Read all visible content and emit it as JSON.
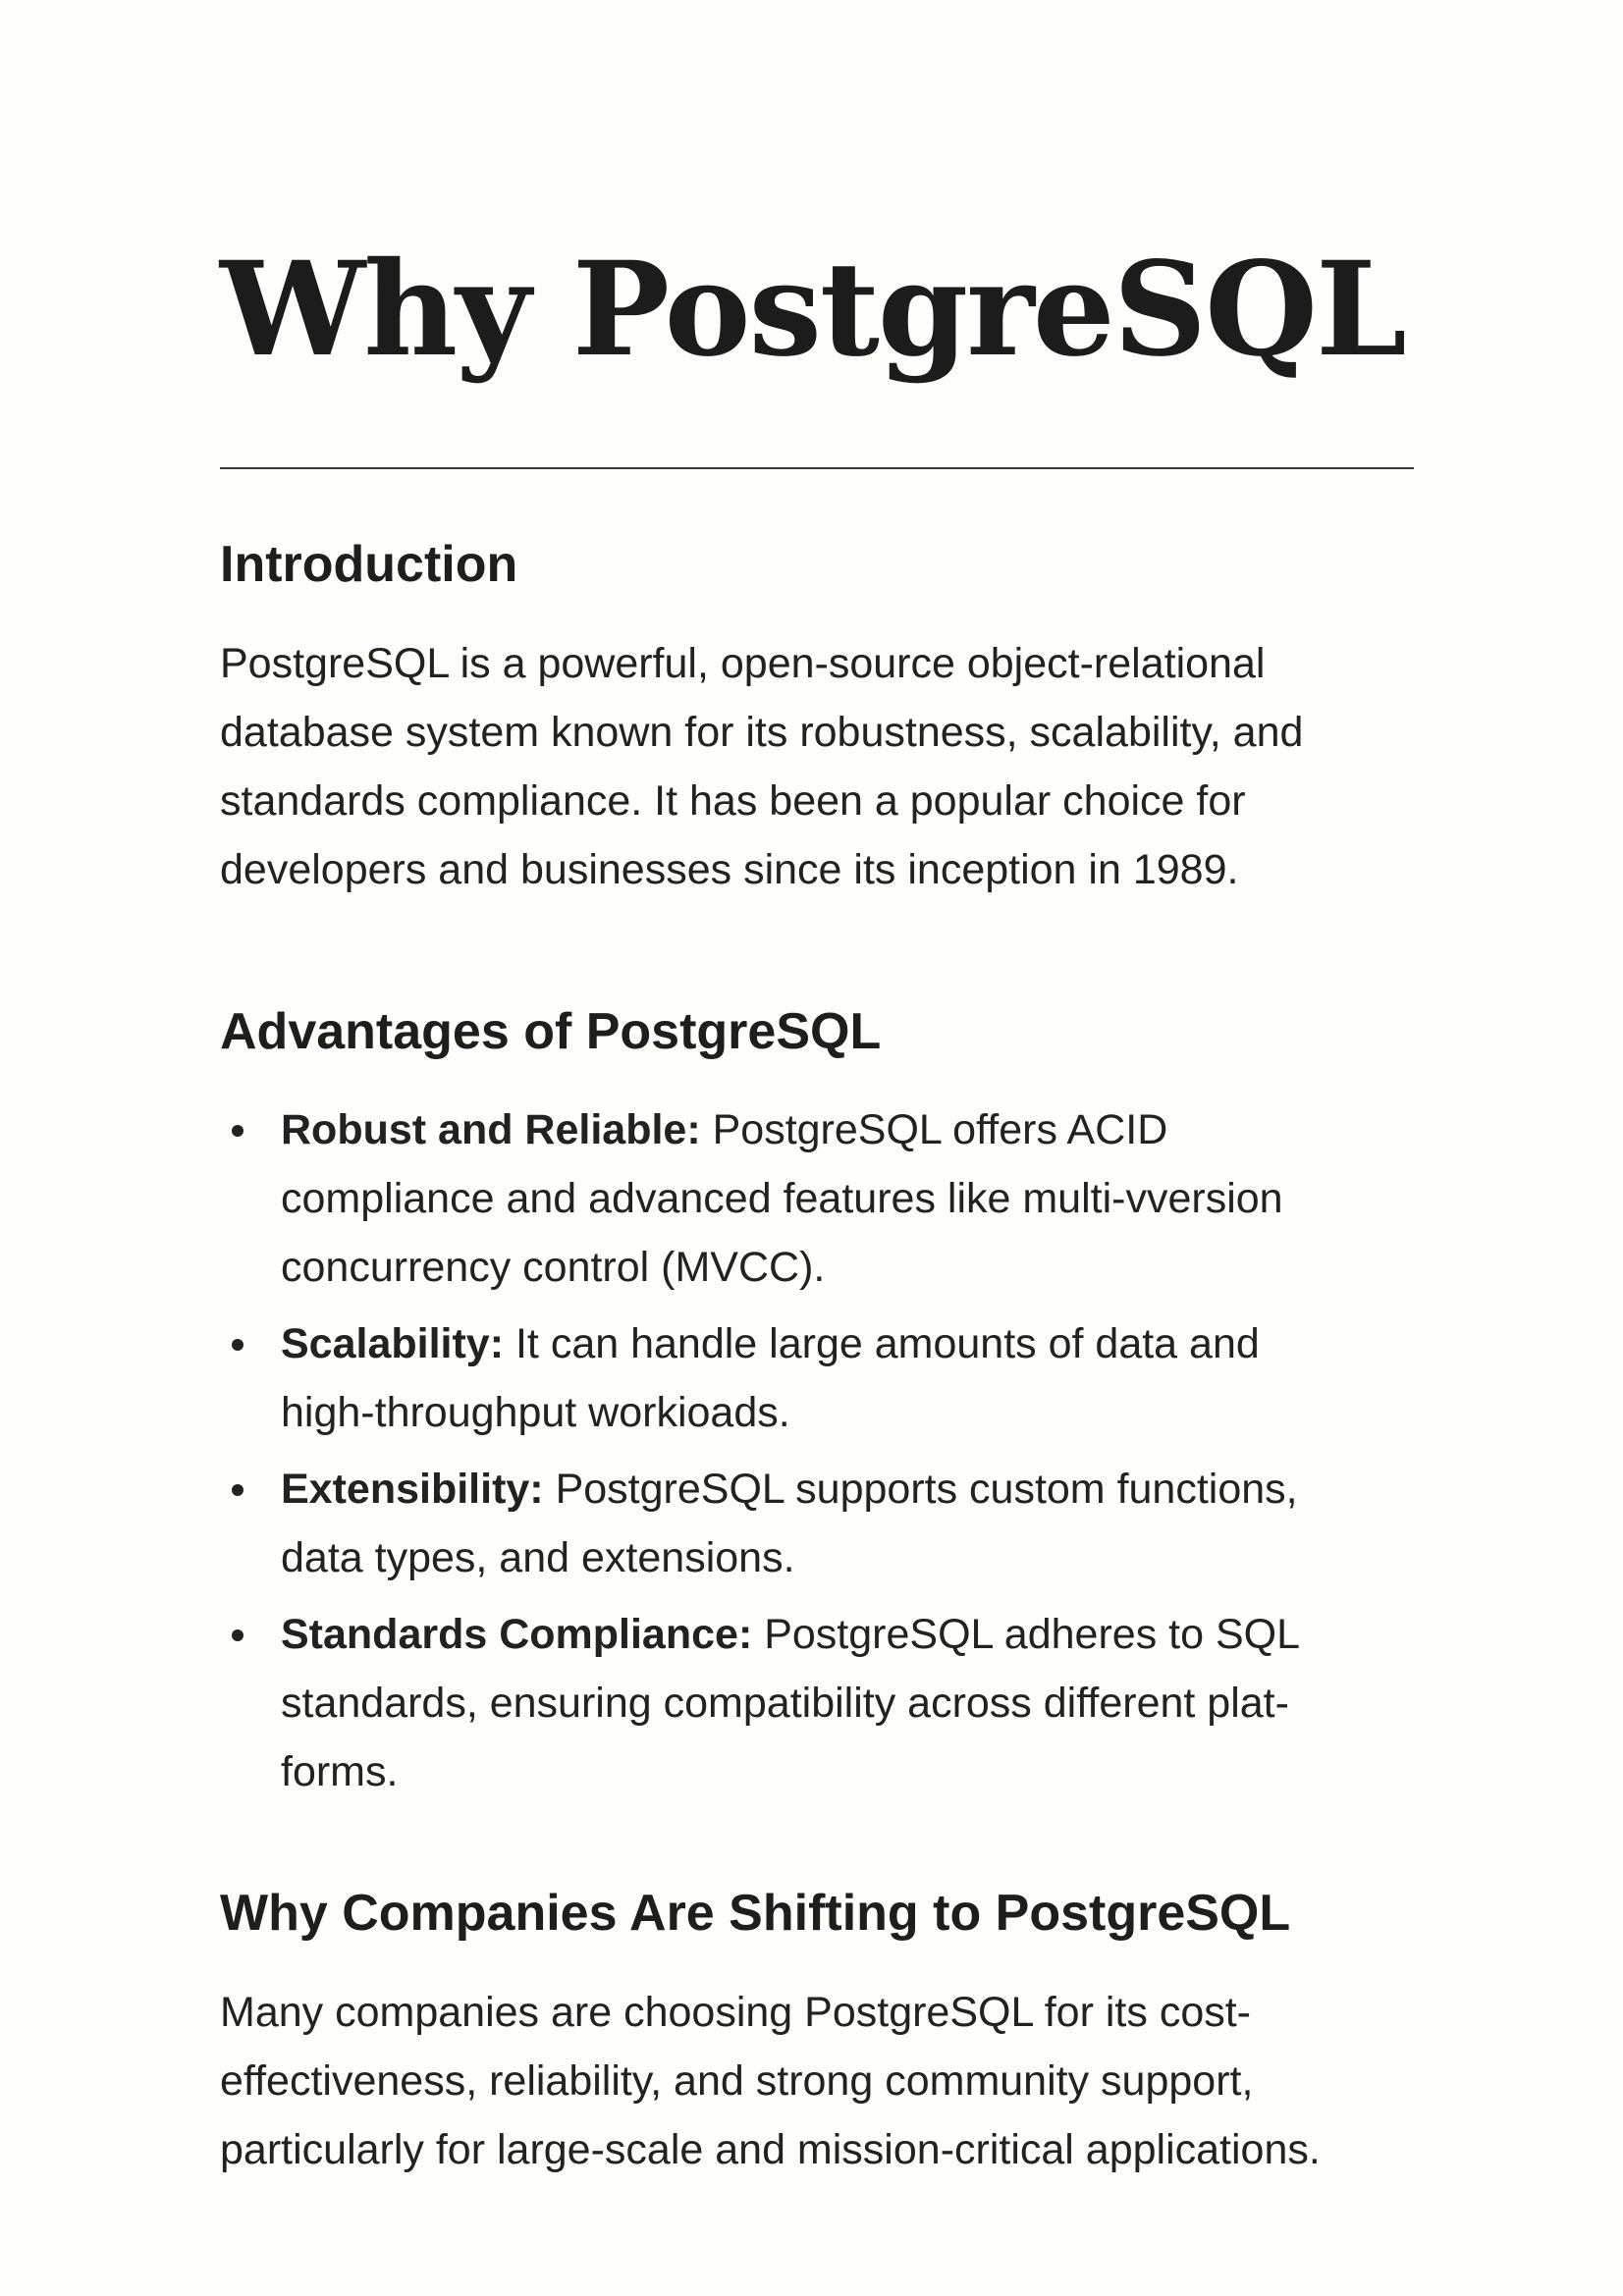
{
  "title": "Why PostgreSQL",
  "intro": {
    "heading": "Introduction",
    "lines": [
      "PostgreSQL is a powerful, open-source object-relational",
      "database system known for its robustness, scalability, and",
      "standards compliance. It has been a popular choice for",
      "developers and businesses since its inception in 1989."
    ]
  },
  "advantages": {
    "heading": "Advantages of PostgreSQL",
    "items": [
      {
        "term": "Robust and Reliable:",
        "lines": [
          " PostgreSQL offers ACID",
          "compliance and advanced features like multi-vversion",
          "concurrency control (MVCC)."
        ]
      },
      {
        "term": "Scalability:",
        "lines": [
          " It can handle large amounts of data and",
          "high-throughput workioads."
        ]
      },
      {
        "term": "Extensibility:",
        "lines": [
          " PostgreSQL supports custom functions,",
          "data types, and extensions."
        ]
      },
      {
        "term": "Standards Compliance:",
        "lines": [
          " PostgreSQL adheres to SQL",
          "standards, ensuring compatibility across different plat-",
          "forms."
        ]
      }
    ]
  },
  "shift": {
    "heading": "Why Companies Are Shifting to PostgreSQL",
    "lines": [
      "Many companies are choosing PostgreSQL for its cost-",
      "effectiveness, reliability, and strong community support,",
      "particularly for large-scale and mission-critical applications."
    ]
  }
}
